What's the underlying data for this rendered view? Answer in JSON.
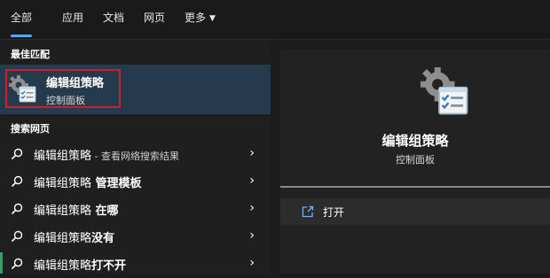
{
  "tabs": [
    {
      "label": "全部",
      "active": true
    },
    {
      "label": "应用"
    },
    {
      "label": "文档"
    },
    {
      "label": "网页"
    },
    {
      "label": "更多"
    }
  ],
  "left": {
    "best_match_heading": "最佳匹配",
    "best_match": {
      "title": "编辑组策略",
      "subtitle": "控制面板",
      "icon": "gpedit-icon"
    },
    "web_heading": "搜索网页",
    "web_results": [
      {
        "text": "编辑组策略",
        "suffix": " - 查看网络搜索结果"
      },
      {
        "text": "编辑组策略",
        "bold": " 管理模板"
      },
      {
        "text": "编辑组策略",
        "bold": " 在哪"
      },
      {
        "text": "编辑组策略",
        "bold": "没有"
      },
      {
        "text": "编辑组策略",
        "bold": "打不开"
      }
    ]
  },
  "right": {
    "title": "编辑组策略",
    "subtitle": "控制面板",
    "actions": [
      {
        "label": "打开",
        "icon": "open-icon"
      }
    ]
  },
  "colors": {
    "accent": "#5aa3ff",
    "highlight_outline": "#d11d24",
    "selected_bg": "#263a4d"
  }
}
